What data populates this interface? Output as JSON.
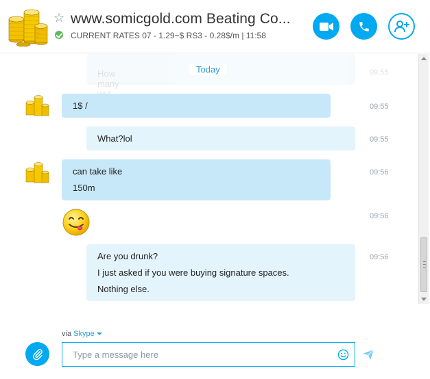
{
  "header": {
    "title": "www.somicgold.com Beating Co...",
    "mood": "CURRENT RATES 07 - 1.29~$ RS3 - 0.28$/m  |  11:58",
    "favorite_icon": "star-outline-icon",
    "status": "online",
    "buttons": [
      {
        "name": "video-call-button",
        "icon": "video-camera-icon"
      },
      {
        "name": "audio-call-button",
        "icon": "phone-icon"
      },
      {
        "name": "add-people-button",
        "icon": "add-person-icon"
      }
    ]
  },
  "conversation": {
    "ghost_text": "How many wul",
    "ghost_time": "09:55",
    "day_label": "Today",
    "messages": [
      {
        "sender": "them",
        "lines": [
          "1$ /"
        ],
        "time": "09:55"
      },
      {
        "sender": "me",
        "lines": [
          "What?lol"
        ],
        "time": "09:55"
      },
      {
        "sender": "them",
        "lines": [
          "can take like",
          "150m"
        ],
        "time": "09:56"
      },
      {
        "sender": "them",
        "emoji": "tongue-out-emoji",
        "lines": [],
        "time": "09:56"
      },
      {
        "sender": "me",
        "lines": [
          "Are you drunk?",
          "I just asked if you were buying signature spaces.",
          "Nothing else."
        ],
        "time": "09:56"
      }
    ]
  },
  "composer": {
    "via_prefix": "via",
    "via_service": "Skype",
    "placeholder": "Type a message here",
    "value": ""
  },
  "colors": {
    "accent": "#00a9f0",
    "incoming_bubble": "#c7e8f9",
    "outgoing_bubble": "#e3f4fc",
    "link": "#2a9fd8"
  }
}
